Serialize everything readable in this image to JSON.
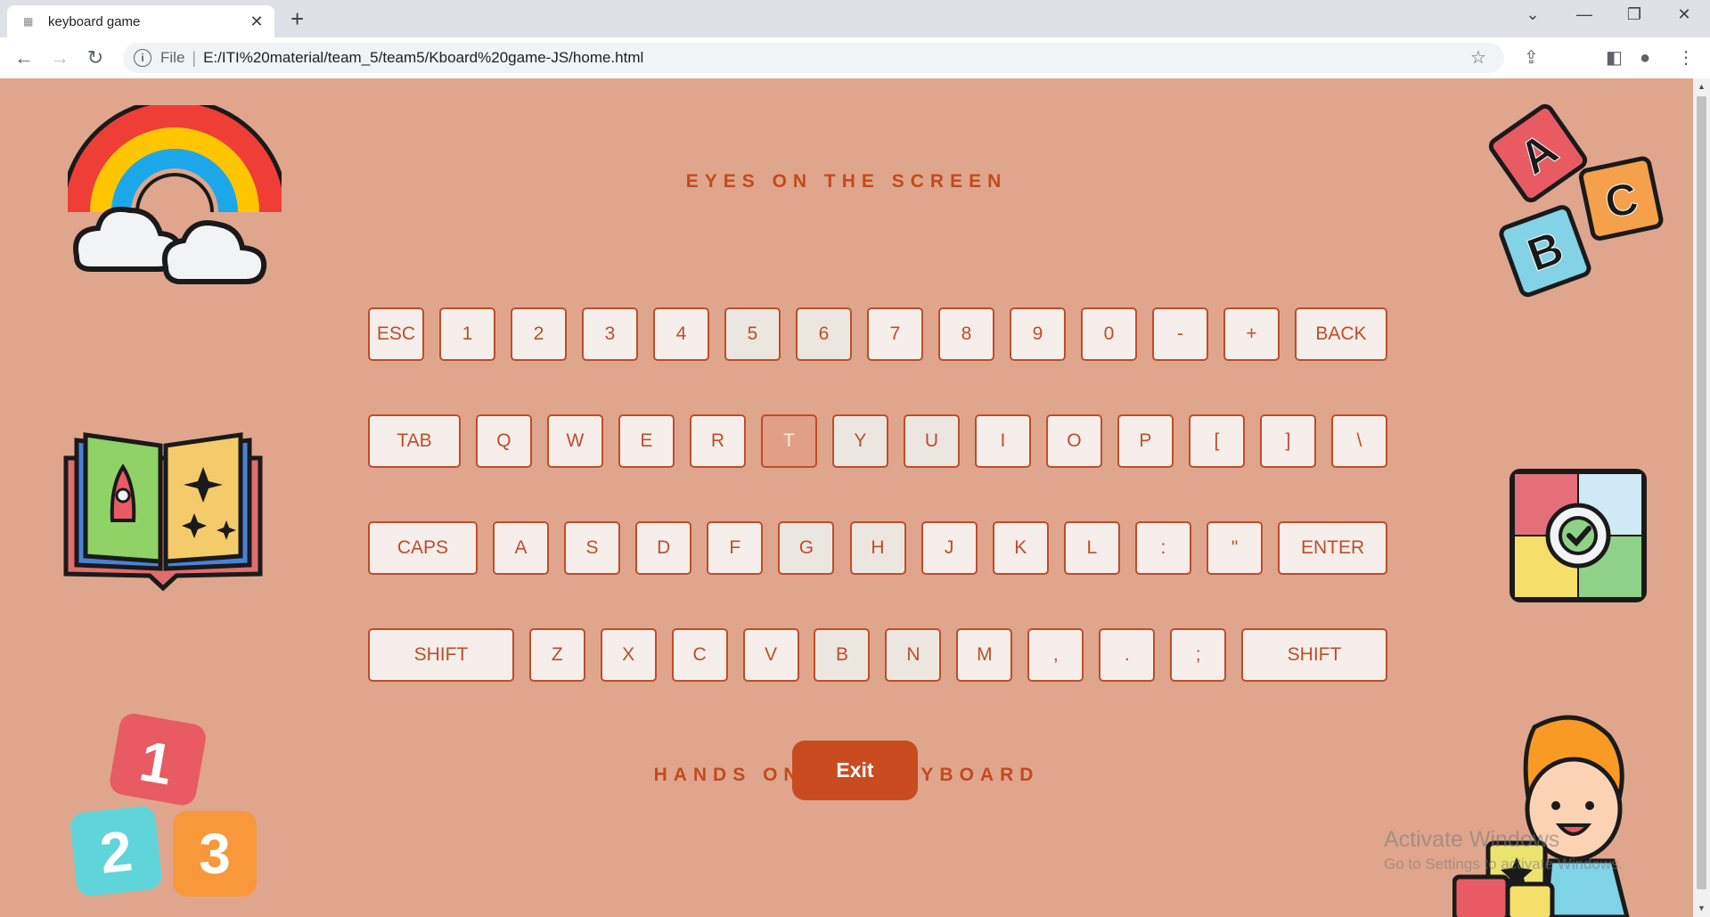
{
  "browser": {
    "tab_title": "keyboard game",
    "new_tab_label": "+",
    "file_label": "File",
    "url": "E:/ITI%20material/team_5/team5/Kboard%20game-JS/home.html"
  },
  "page": {
    "top_heading": "EYES ON THE SCREEN",
    "bottom_heading": "HANDS ON THE KEYBOARD",
    "exit_label": "Exit",
    "watermark_title": "Activate Windows",
    "watermark_sub": "Go to Settings to activate Windows.",
    "colors": {
      "background": "#dfa68d",
      "accent": "#c84c1f",
      "key_border": "#c04d28",
      "key_face": "#f5eeeb"
    }
  },
  "keyboard": {
    "active_key": "T",
    "rows": [
      [
        "ESC",
        "1",
        "2",
        "3",
        "4",
        "5",
        "6",
        "7",
        "8",
        "9",
        "0",
        "-",
        "+",
        "BACK"
      ],
      [
        "TAB",
        "Q",
        "W",
        "E",
        "R",
        "T",
        "Y",
        "U",
        "I",
        "O",
        "P",
        "[",
        "]",
        "\\"
      ],
      [
        "CAPS",
        "A",
        "S",
        "D",
        "F",
        "G",
        "H",
        "J",
        "K",
        "L",
        ":",
        "\"",
        "ENTER"
      ],
      [
        "SHIFT",
        "Z",
        "X",
        "C",
        "V",
        "B",
        "N",
        "M",
        ",",
        ".",
        ";",
        "SHIFT"
      ]
    ]
  },
  "decorations": {
    "abc_blocks": [
      "A",
      "B",
      "C"
    ],
    "number_blocks": [
      "1",
      "2",
      "3"
    ]
  }
}
